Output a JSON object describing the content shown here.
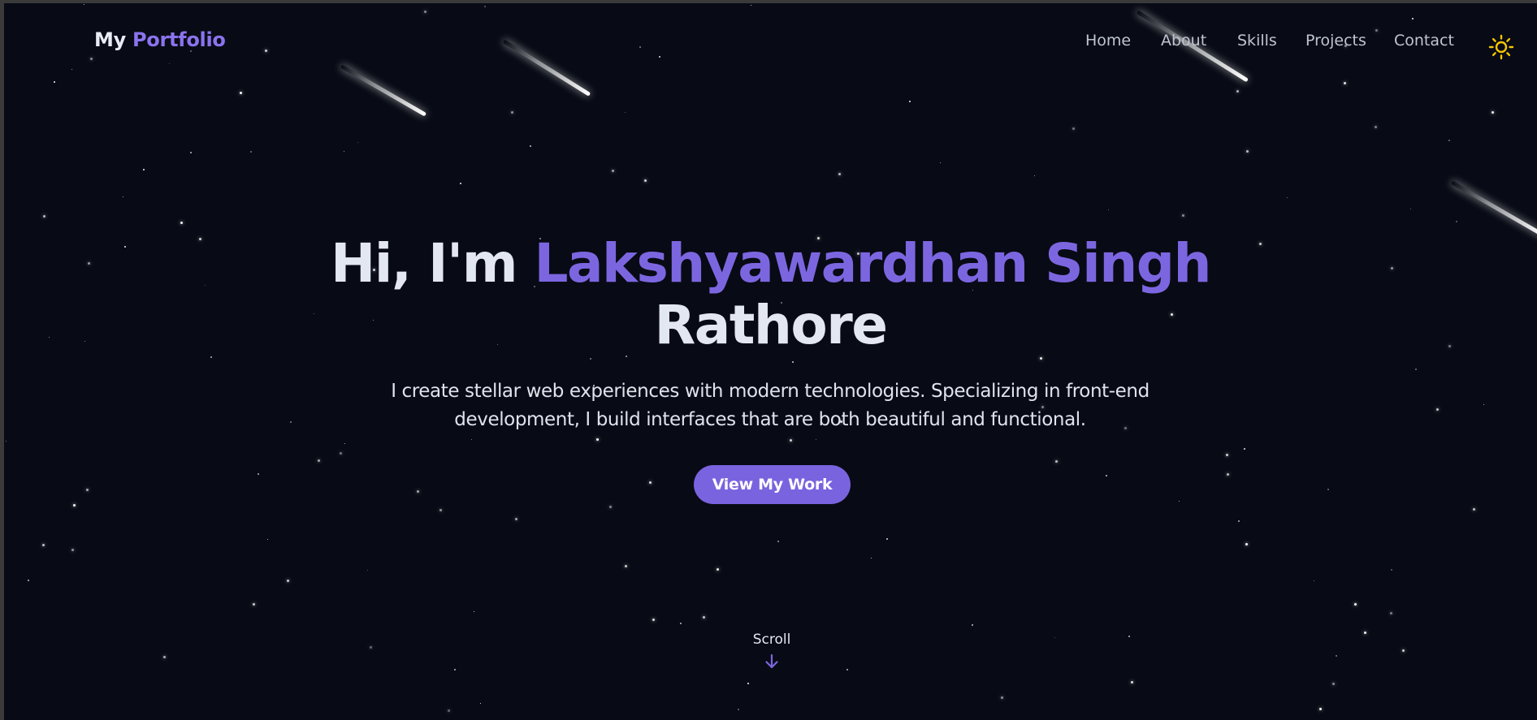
{
  "navbar": {
    "logo_prefix": "My",
    "logo_accent": "Portfolio",
    "links": [
      {
        "label": "Home"
      },
      {
        "label": "About"
      },
      {
        "label": "Skills"
      },
      {
        "label": "Projects"
      },
      {
        "label": "Contact"
      }
    ],
    "theme_toggle_icon": "sun-icon"
  },
  "hero": {
    "greeting": "Hi, I'm",
    "name": "Lakshyawardhan Singh",
    "surname": "Rathore",
    "subtitle": "I create stellar web experiences with modern technologies. Specializing in front-end development, I build interfaces that are both beautiful and functional.",
    "cta_label": "View My Work"
  },
  "scroll": {
    "label": "Scroll",
    "icon": "arrow-down-icon"
  },
  "colors": {
    "background": "#080b15",
    "accent": "#7c66e0",
    "text": "#e3e7f1",
    "sun": "#f5c400"
  }
}
